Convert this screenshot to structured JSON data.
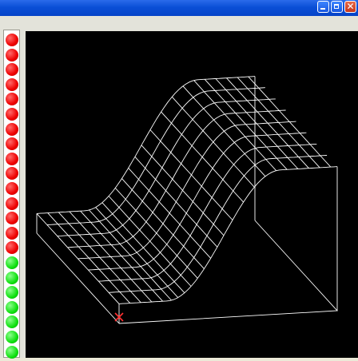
{
  "window": {
    "controls": [
      "minimize",
      "maximize",
      "close"
    ]
  },
  "status_indicators": {
    "colors": {
      "red": "#ee0000",
      "green": "#10e010"
    },
    "states": [
      "red",
      "red",
      "red",
      "red",
      "red",
      "red",
      "red",
      "red",
      "red",
      "red",
      "red",
      "red",
      "red",
      "red",
      "red",
      "green",
      "green",
      "green",
      "green",
      "green",
      "green",
      "green"
    ]
  },
  "viewport": {
    "background": "#000000",
    "mesh_color": "#ffffff",
    "origin_marker_icon": "x-cross-icon",
    "origin_marker_color": "#ff3030"
  }
}
